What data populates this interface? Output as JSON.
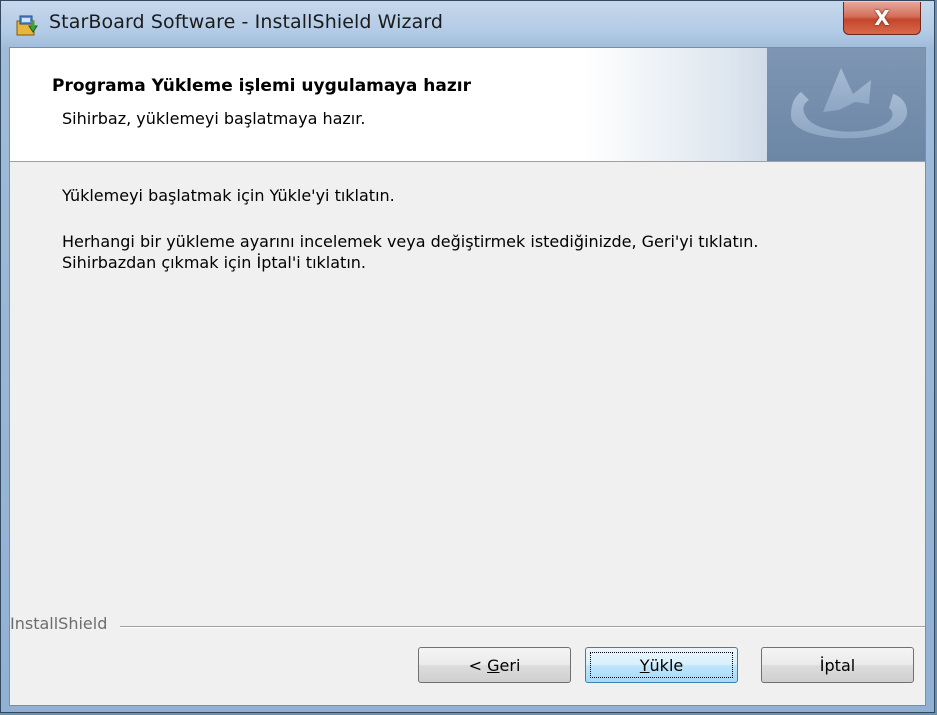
{
  "window": {
    "title": "StarBoard Software - InstallShield Wizard",
    "close_label": "X"
  },
  "header": {
    "title": "Programa Yükleme işlemi uygulamaya hazır",
    "subtitle": "Sihirbaz, yüklemeyi başlatmaya hazır."
  },
  "body": {
    "line1": "Yüklemeyi başlatmak için Yükle'yi tıklatın.",
    "line2": "Herhangi bir yükleme ayarını incelemek veya değiştirmek istediğinizde, Geri'yi tıklatın.",
    "line3": "Sihirbazdan çıkmak için İptal'i tıklatın."
  },
  "footer": {
    "brand": "InstallShield"
  },
  "buttons": {
    "back_prefix": "< ",
    "back_hotkey": "G",
    "back_rest": "eri",
    "install_hotkey": "Y",
    "install_rest": "ükle",
    "cancel": "İptal"
  },
  "colors": {
    "titlebar": "#b3cbe6",
    "close_button": "#c4462c",
    "dialog_bg": "#f0f0f0",
    "default_button": "#bee6fd"
  },
  "icons": {
    "title": "installer-icon",
    "header": "installshield-logo-icon",
    "close": "close-icon"
  }
}
